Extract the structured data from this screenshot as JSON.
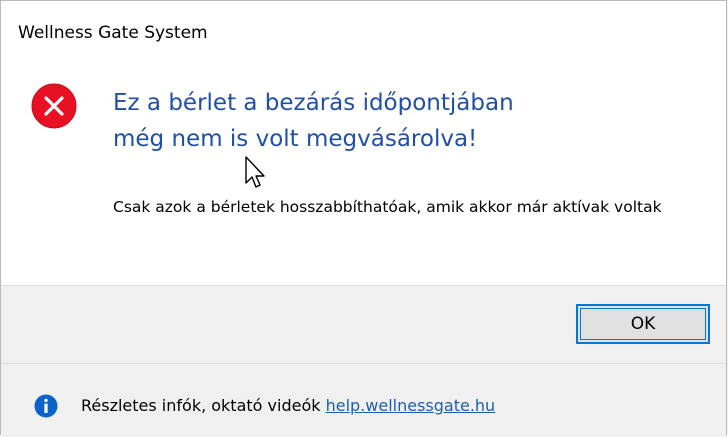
{
  "window": {
    "title": "Wellness Gate System"
  },
  "message": {
    "main_instruction": "Ez a bérlet a bezárás időpontjában még nem is volt megvásárolva!",
    "body": "Csak azok a bérletek hosszabbíthatóak, amik akkor már aktívak voltak"
  },
  "buttons": {
    "ok_label": "OK"
  },
  "footer": {
    "text": "Részletes infók, oktató videók",
    "link_text": "help.wellnessgate.hu"
  },
  "icons": {
    "main": "error-icon",
    "footer": "info-icon"
  },
  "colors": {
    "instruction": "#1f4fa8",
    "error_red": "#e81123",
    "info_blue": "#0a63c9",
    "focus_border": "#0078d7",
    "link": "#1a5fb4"
  }
}
